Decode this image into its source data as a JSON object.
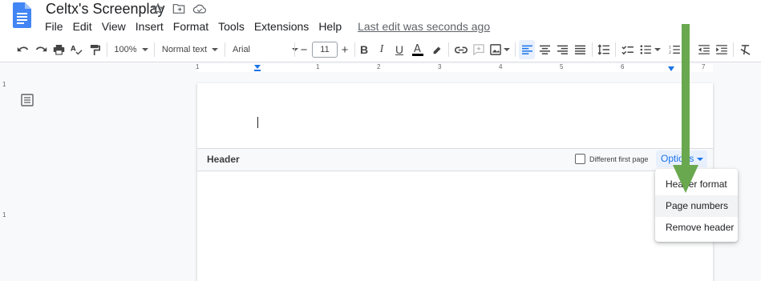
{
  "window": {
    "title": "Celtx's Screenplay",
    "menu": [
      "File",
      "Edit",
      "View",
      "Insert",
      "Format",
      "Tools",
      "Extensions",
      "Help"
    ],
    "last_edit": "Last edit was seconds ago"
  },
  "toolbar": {
    "zoom": "100%",
    "style": "Normal text",
    "font": "Arial",
    "font_size": "11",
    "minus": "−",
    "plus": "+"
  },
  "ruler": {
    "h_ticks": [
      "1",
      "1",
      "2",
      "3",
      "4",
      "5",
      "6",
      "7"
    ],
    "v_ticks": [
      "1",
      "1"
    ]
  },
  "header_section": {
    "label": "Header",
    "different_first_page": "Different first page",
    "options": "Options"
  },
  "options_menu": {
    "items": [
      "Header format",
      "Page numbers",
      "Remove header"
    ]
  },
  "colors": {
    "accent": "#1a73e8",
    "arrow": "#6aa84f",
    "doc_blue": "#4285f4"
  }
}
